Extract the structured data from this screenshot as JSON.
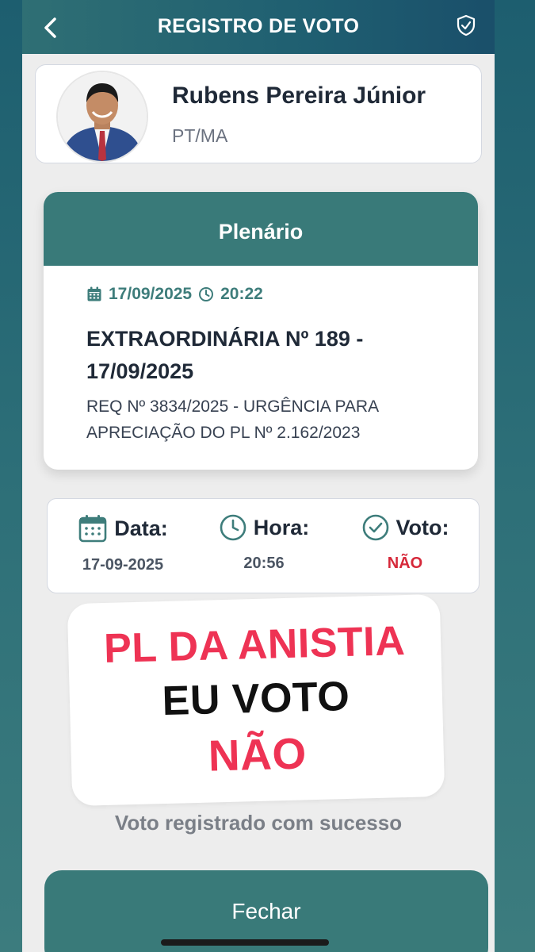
{
  "header": {
    "title": "REGISTRO DE VOTO",
    "back_icon": "chevron-left-icon",
    "shield_icon": "shield-check-icon"
  },
  "profile": {
    "name": "Rubens Pereira Júnior",
    "party": "PT/MA"
  },
  "session": {
    "header": "Plenário",
    "date": "17/09/2025",
    "time": "20:22",
    "title": "EXTRAORDINÁRIA Nº 189 - 17/09/2025",
    "description": "REQ Nº 3834/2025 - URGÊNCIA PARA APRECIAÇÃO DO PL Nº 2.162/2023"
  },
  "vote": {
    "data_label": "Data:",
    "data_value": "17-09-2025",
    "hora_label": "Hora:",
    "hora_value": "20:56",
    "voto_label": "Voto:",
    "voto_value": "NÃO"
  },
  "sticker": {
    "line1": "PL DA ANISTIA",
    "line2": "EU VOTO",
    "line3": "NÃO"
  },
  "status_text": "Voto registrado com sucesso",
  "close_button": "Fechar",
  "colors": {
    "teal": "#397a79",
    "accent_red": "#ee3354",
    "vote_red": "#d6293a"
  }
}
